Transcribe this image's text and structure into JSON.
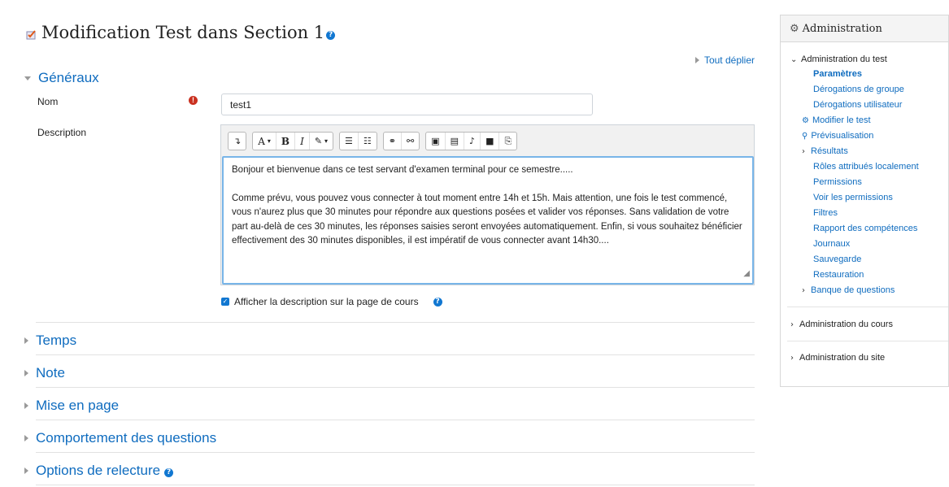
{
  "page": {
    "title": "Modification Test dans Section 1",
    "expand_all": "Tout déplier"
  },
  "general": {
    "heading": "Généraux",
    "name_label": "Nom",
    "name_value": "test1",
    "description_label": "Description",
    "description_paragraphs": [
      "Bonjour et bienvenue dans ce test servant d'examen terminal pour ce semestre.....",
      "Comme prévu, vous pouvez vous connecter à tout moment entre 14h et 15h. Mais attention, une fois le test commencé, vous n'aurez plus que 30 minutes pour répondre aux questions posées et valider vos réponses. Sans validation de votre part au-delà de ces 30 minutes, les réponses saisies seront envoyées automatiquement. Enfin, si vous souhaitez bénéficier effectivement des 30 minutes disponibles, il est impératif de vous connecter avant 14h30...."
    ],
    "show_description_label": "Afficher la description sur la page de cours",
    "show_description_checked": true
  },
  "toolbar": {
    "collapse": "↴",
    "font": "A",
    "bold": "B",
    "italic": "I",
    "style": "✎",
    "bullet_list": "☰",
    "numbered_list": "☷",
    "link": "⚭",
    "unlink": "⚯",
    "image": "▣",
    "media": "▤",
    "record_audio": "♪",
    "record_video": "■",
    "manage_files": "⎘",
    "icons": [
      "collapse-icon",
      "font-color-icon",
      "bold-icon",
      "italic-icon",
      "paragraph-style-icon",
      "bullet-list-icon",
      "numbered-list-icon",
      "link-icon",
      "unlink-icon",
      "image-icon",
      "media-icon",
      "microphone-icon",
      "video-icon",
      "files-icon"
    ]
  },
  "sections": [
    {
      "label": "Temps"
    },
    {
      "label": "Note"
    },
    {
      "label": "Mise en page"
    },
    {
      "label": "Comportement des questions"
    },
    {
      "label": "Options de relecture"
    }
  ],
  "admin": {
    "title": "Administration",
    "quiz_admin": "Administration du test",
    "items": [
      {
        "label": "Paramètres"
      },
      {
        "label": "Dérogations de groupe"
      },
      {
        "label": "Dérogations utilisateur"
      },
      {
        "label": "Modifier le test"
      },
      {
        "label": "Prévisualisation"
      },
      {
        "label": "Résultats"
      },
      {
        "label": "Rôles attribués localement"
      },
      {
        "label": "Permissions"
      },
      {
        "label": "Voir les permissions"
      },
      {
        "label": "Filtres"
      },
      {
        "label": "Rapport des compétences"
      },
      {
        "label": "Journaux"
      },
      {
        "label": "Sauvegarde"
      },
      {
        "label": "Restauration"
      },
      {
        "label": "Banque de questions"
      }
    ],
    "course_admin": "Administration du cours",
    "site_admin": "Administration du site"
  },
  "colors": {
    "link": "#0f6cbf",
    "help": "#1177d1",
    "required": "#ca3120",
    "editor_focus": "#78b5e8"
  }
}
